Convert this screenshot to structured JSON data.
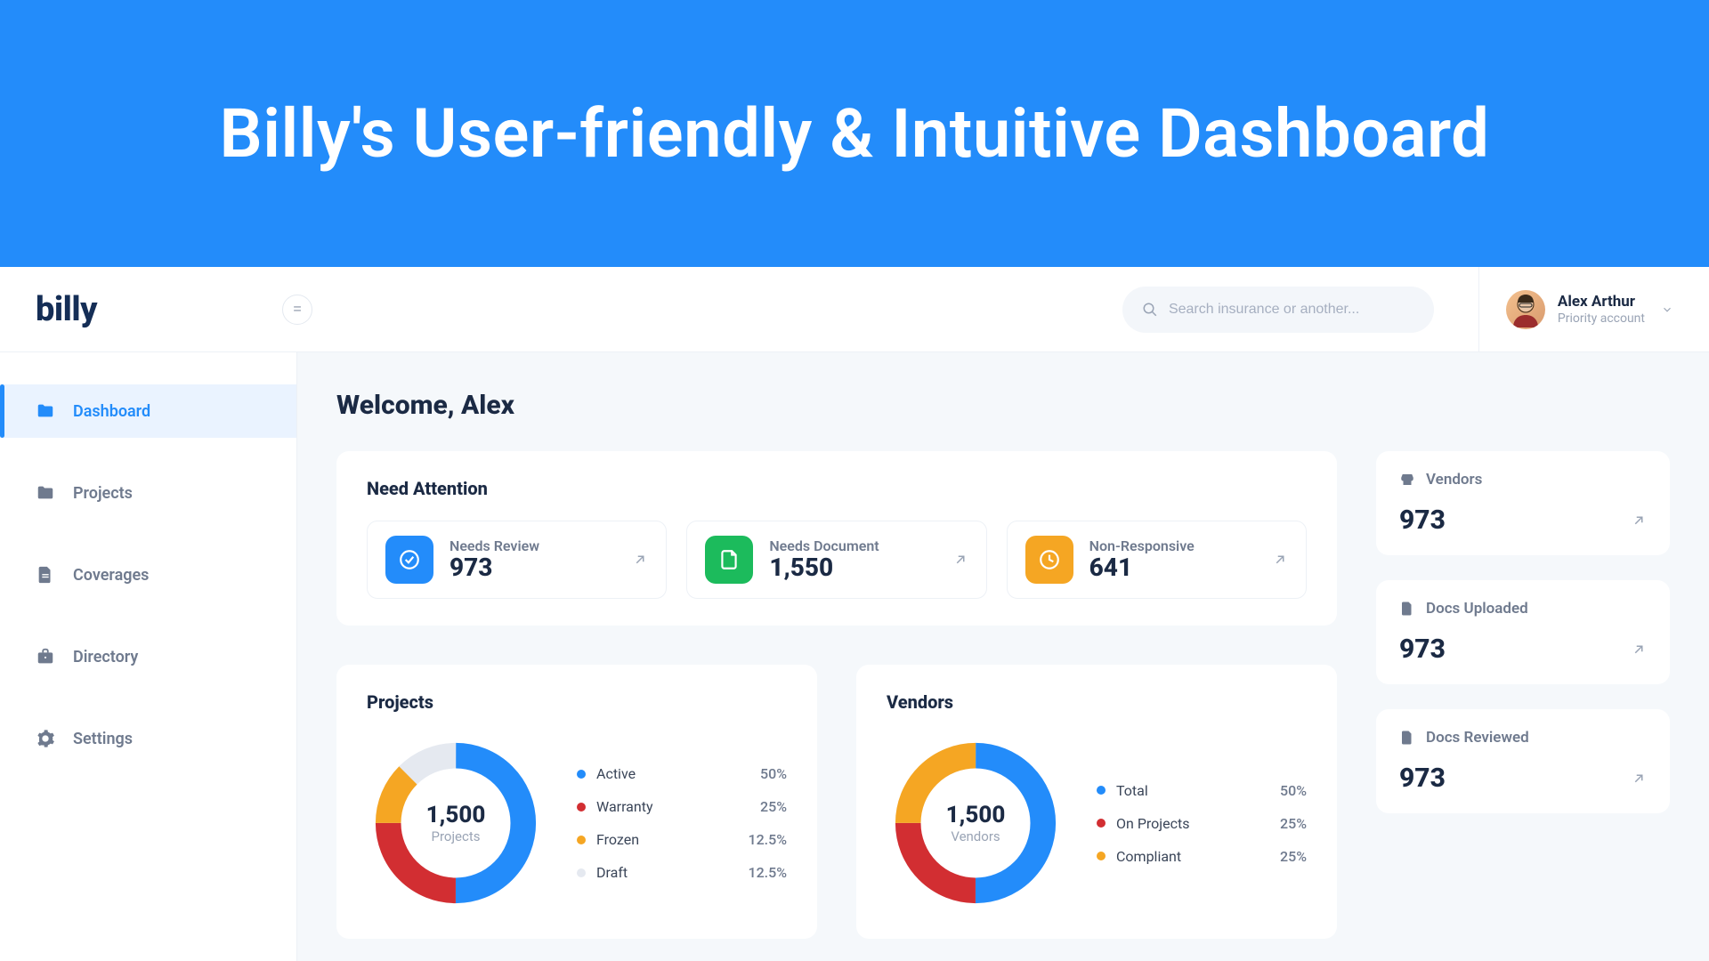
{
  "hero": {
    "title": "Billy's User-friendly & Intuitive Dashboard"
  },
  "brand": {
    "name": "billy"
  },
  "search": {
    "placeholder": "Search insurance or another..."
  },
  "user": {
    "name": "Alex Arthur",
    "subtitle": "Priority account"
  },
  "sidebar": {
    "items": [
      {
        "label": "Dashboard",
        "active": true
      },
      {
        "label": "Projects",
        "active": false
      },
      {
        "label": "Coverages",
        "active": false
      },
      {
        "label": "Directory",
        "active": false
      },
      {
        "label": "Settings",
        "active": false
      }
    ]
  },
  "main": {
    "welcome": "Welcome, Alex",
    "attention": {
      "title": "Need Attention",
      "cards": [
        {
          "label": "Needs Review",
          "value": "973",
          "color": "blue"
        },
        {
          "label": "Needs Document",
          "value": "1,550",
          "color": "green"
        },
        {
          "label": "Non-Responsive",
          "value": "641",
          "color": "amber"
        }
      ]
    },
    "projects": {
      "title": "Projects",
      "center_value": "1,500",
      "center_label": "Projects",
      "legend": [
        {
          "name": "Active",
          "value": "50%",
          "color": "#238cfa"
        },
        {
          "name": "Warranty",
          "value": "25%",
          "color": "#d22e32"
        },
        {
          "name": "Frozen",
          "value": "12.5%",
          "color": "#f5a623"
        },
        {
          "name": "Draft",
          "value": "12.5%",
          "color": "#e5e9f0"
        }
      ]
    },
    "vendors": {
      "title": "Vendors",
      "center_value": "1,500",
      "center_label": "Vendors",
      "legend": [
        {
          "name": "Total",
          "value": "50%",
          "color": "#238cfa"
        },
        {
          "name": "On Projects",
          "value": "25%",
          "color": "#d22e32"
        },
        {
          "name": "Compliant",
          "value": "25%",
          "color": "#f5a623"
        }
      ]
    },
    "side": [
      {
        "label": "Vendors",
        "value": "973"
      },
      {
        "label": "Docs Uploaded",
        "value": "973"
      },
      {
        "label": "Docs Reviewed",
        "value": "973"
      }
    ]
  },
  "colors": {
    "blue": "#238cfa",
    "green": "#1cbb5c",
    "amber": "#f5a623",
    "red": "#d22e32",
    "gray": "#e5e9f0"
  },
  "chart_data": [
    {
      "type": "pie",
      "title": "Projects",
      "center": "1,500 Projects",
      "series": [
        {
          "name": "Active",
          "value": 50,
          "color": "#238cfa"
        },
        {
          "name": "Warranty",
          "value": 25,
          "color": "#d22e32"
        },
        {
          "name": "Frozen",
          "value": 12.5,
          "color": "#f5a623"
        },
        {
          "name": "Draft",
          "value": 12.5,
          "color": "#e5e9f0"
        }
      ]
    },
    {
      "type": "pie",
      "title": "Vendors",
      "center": "1,500 Vendors",
      "series": [
        {
          "name": "Total",
          "value": 50,
          "color": "#238cfa"
        },
        {
          "name": "On Projects",
          "value": 25,
          "color": "#d22e32"
        },
        {
          "name": "Compliant",
          "value": 25,
          "color": "#f5a623"
        }
      ]
    }
  ]
}
